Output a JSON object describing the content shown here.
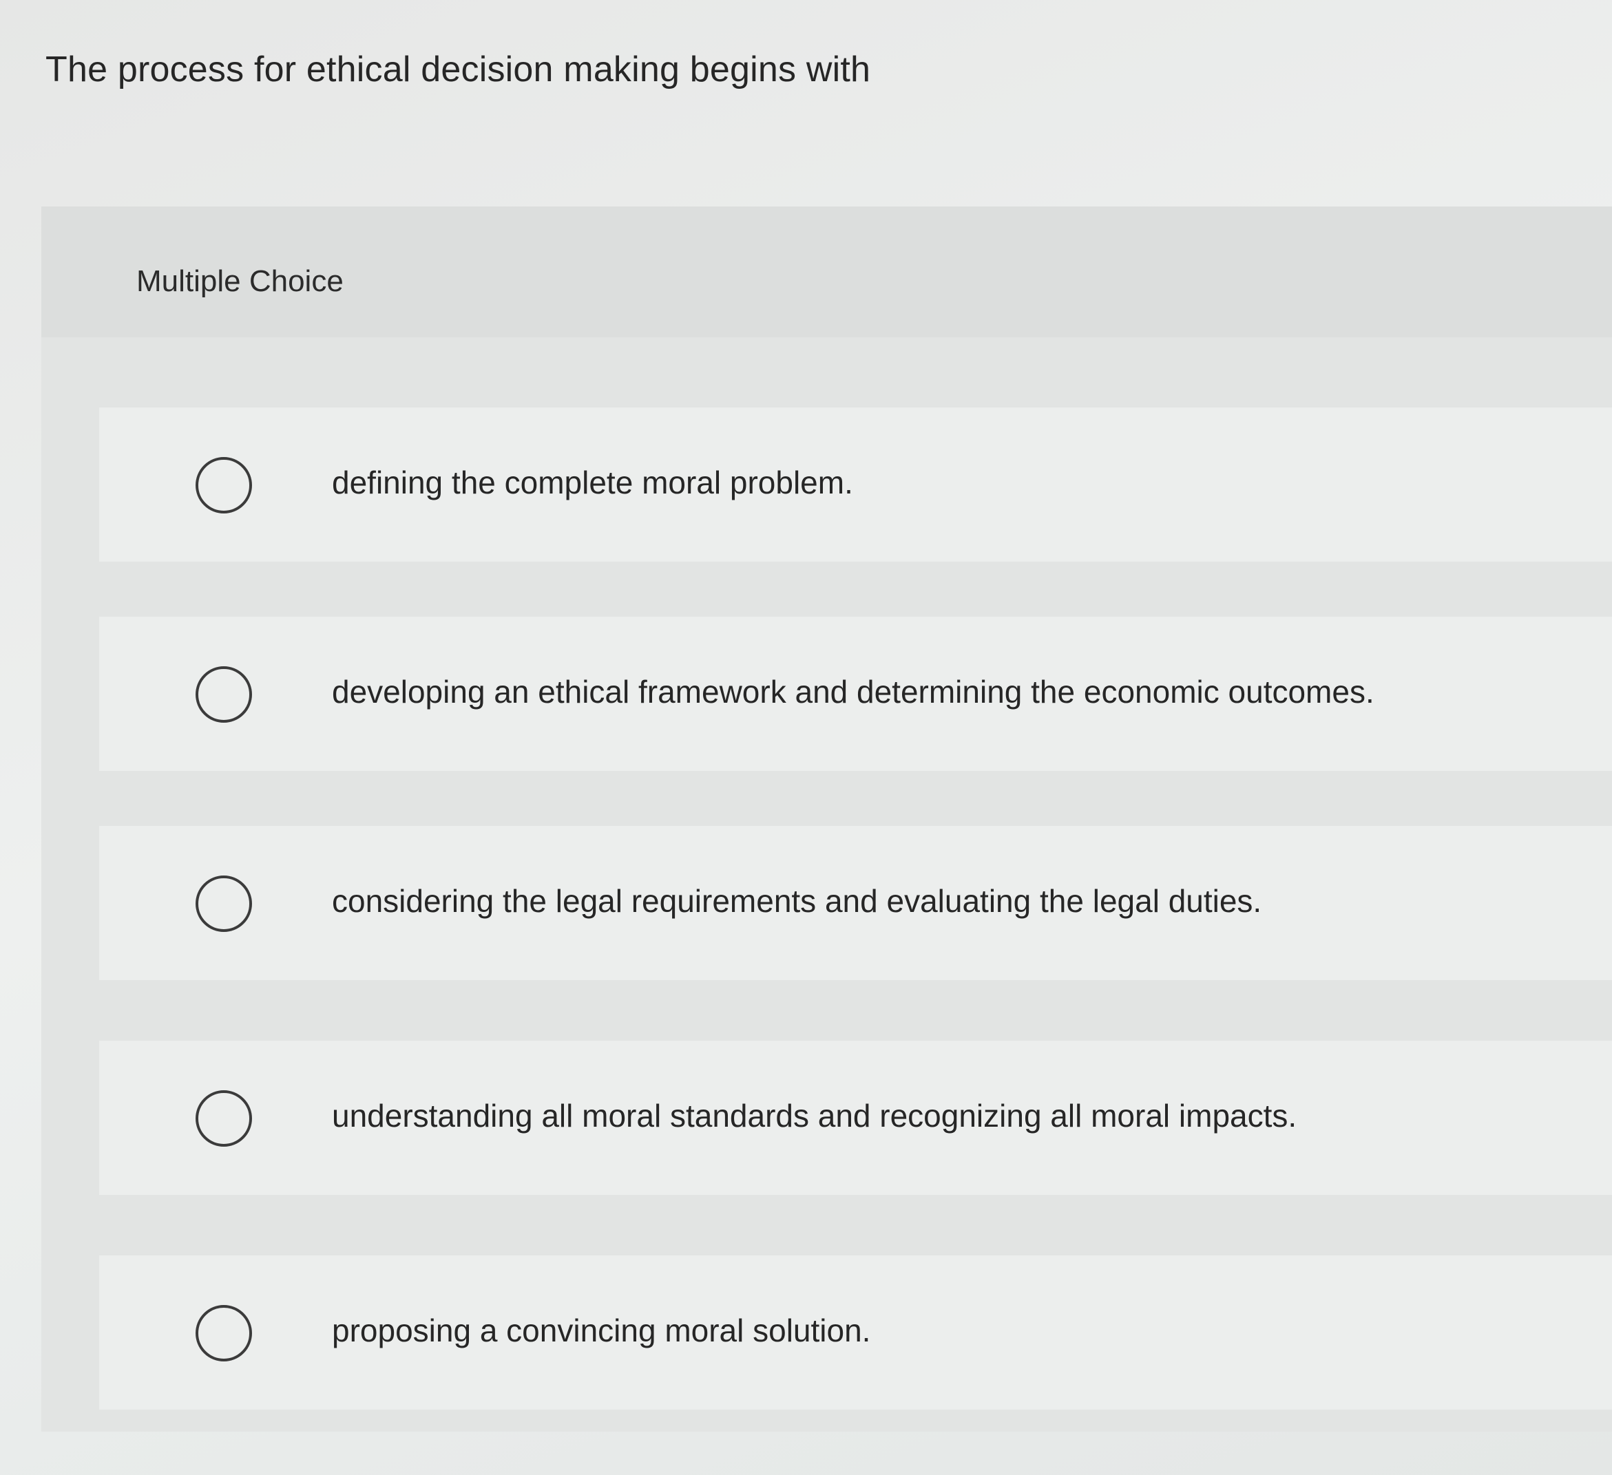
{
  "question": {
    "text": "The process for ethical decision making begins with"
  },
  "panel": {
    "type_label": "Multiple Choice"
  },
  "options": [
    {
      "label": "defining the complete moral problem."
    },
    {
      "label": "developing an ethical framework and determining the economic outcomes."
    },
    {
      "label": "considering the legal requirements and evaluating the legal duties."
    },
    {
      "label": "understanding all moral standards and recognizing all moral impacts."
    },
    {
      "label": "proposing a convincing moral solution."
    }
  ],
  "colors": {
    "background": "#eceeed",
    "panel": "#e2e4e3",
    "text": "#262626",
    "radio_border": "#3b3b3b"
  }
}
